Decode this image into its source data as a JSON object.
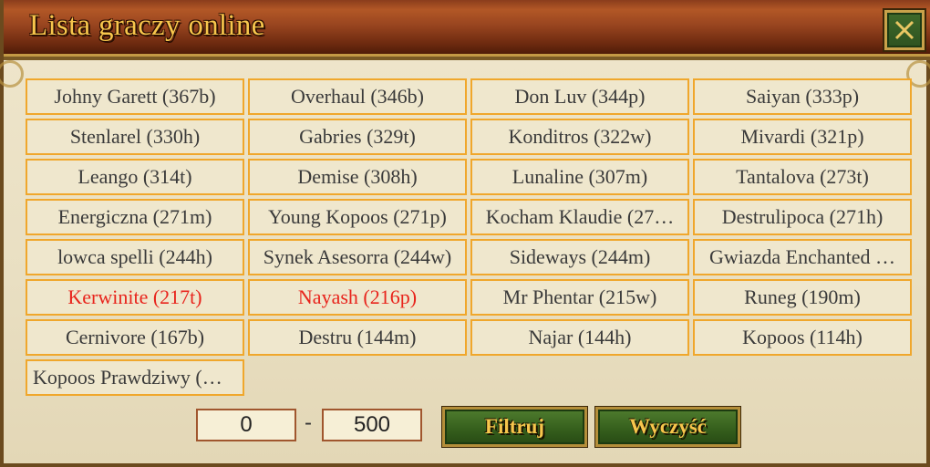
{
  "window": {
    "title": "Lista graczy online"
  },
  "players": [
    {
      "label": "Johny Garett (367b)",
      "color": "#3a3a3a"
    },
    {
      "label": "Overhaul (346b)",
      "color": "#3a3a3a"
    },
    {
      "label": "Don Luv (344p)",
      "color": "#3a3a3a"
    },
    {
      "label": "Saiyan (333p)",
      "color": "#3a3a3a"
    },
    {
      "label": "Stenlarel (330h)",
      "color": "#3a3a3a"
    },
    {
      "label": "Gabries (329t)",
      "color": "#3a3a3a"
    },
    {
      "label": "Konditros (322w)",
      "color": "#3a3a3a"
    },
    {
      "label": "Mivardi (321p)",
      "color": "#3a3a3a"
    },
    {
      "label": "Leango (314t)",
      "color": "#3a3a3a"
    },
    {
      "label": "Demise (308h)",
      "color": "#3a3a3a"
    },
    {
      "label": "Lunaline (307m)",
      "color": "#3a3a3a"
    },
    {
      "label": "Tantalova (273t)",
      "color": "#3a3a3a"
    },
    {
      "label": "Energiczna (271m)",
      "color": "#3a3a3a"
    },
    {
      "label": "Young Kopoos (271p)",
      "color": "#3a3a3a"
    },
    {
      "label": "Kocham Klaudie (27…",
      "color": "#3a3a3a"
    },
    {
      "label": "Destrulipoca (271h)",
      "color": "#3a3a3a"
    },
    {
      "label": "lowca spelli (244h)",
      "color": "#3a3a3a"
    },
    {
      "label": "Synek Asesorra (244w)",
      "color": "#3a3a3a"
    },
    {
      "label": "Sideways (244m)",
      "color": "#3a3a3a"
    },
    {
      "label": "Gwiazda Enchanted …",
      "color": "#3a3a3a"
    },
    {
      "label": "Kerwinite (217t)",
      "color": "#e8241c"
    },
    {
      "label": "Nayash (216p)",
      "color": "#e8241c"
    },
    {
      "label": "Mr Phentar (215w)",
      "color": "#3a3a3a"
    },
    {
      "label": "Runeg (190m)",
      "color": "#3a3a3a"
    },
    {
      "label": "Cernivore (167b)",
      "color": "#3a3a3a"
    },
    {
      "label": "Destru (144m)",
      "color": "#3a3a3a"
    },
    {
      "label": "Najar (144h)",
      "color": "#3a3a3a"
    },
    {
      "label": "Kopoos (114h)",
      "color": "#3a3a3a"
    },
    {
      "label": "Kopoos Prawdziwy (…",
      "color": "#3a3a3a"
    }
  ],
  "filter": {
    "min_value": "0",
    "separator": "-",
    "max_value": "500",
    "filter_label": "Filtruj",
    "clear_label": "Wyczyść"
  },
  "icons": {
    "close": "close-x-icon"
  }
}
